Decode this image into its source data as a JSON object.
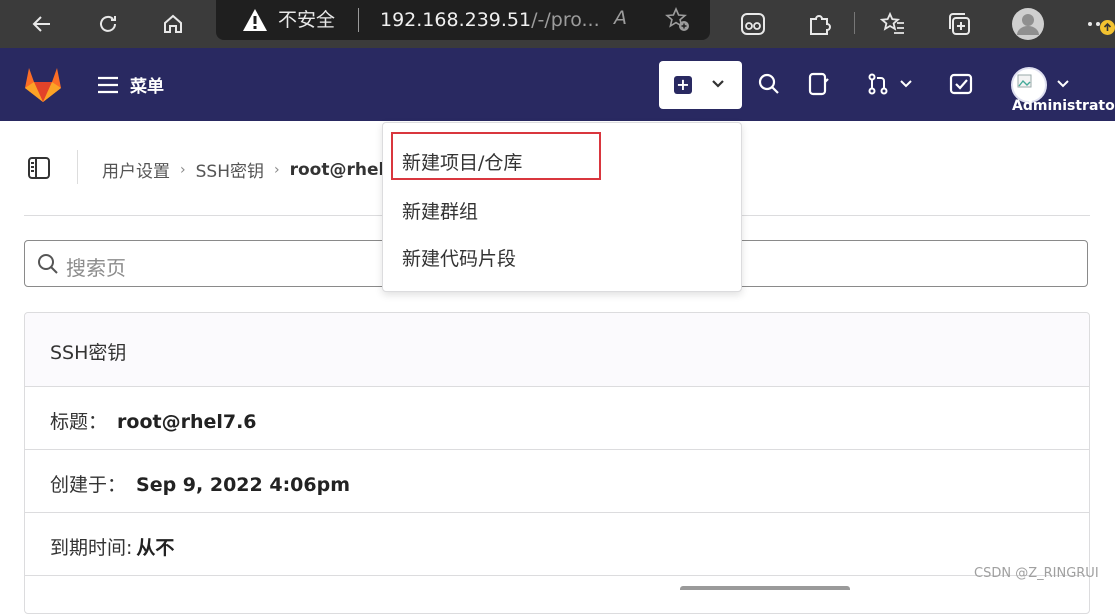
{
  "browser": {
    "insecure_label": "不安全",
    "url_host": "192.168.239.51",
    "url_path": "/-/pro...",
    "read_aloud": "A"
  },
  "nav": {
    "menu_label": "菜单",
    "user_name": "Administrato"
  },
  "breadcrumb": {
    "items": [
      "用户设置",
      "SSH密钥"
    ],
    "current": "root@rhel"
  },
  "search": {
    "placeholder": "搜索页"
  },
  "ssh_key": {
    "title": "SSH密钥",
    "rows": [
      {
        "label": "标题：",
        "value": "root@rhel7.6"
      },
      {
        "label": "创建于：",
        "value": "Sep 9, 2022 4:06pm"
      },
      {
        "label": "到期时间:",
        "value": "从不"
      }
    ]
  },
  "new_menu": {
    "items": [
      {
        "label": "新建项目/仓库",
        "highlighted": true
      },
      {
        "label": "新建群组"
      },
      {
        "label": "新建代码片段"
      }
    ]
  },
  "watermark": "CSDN @Z_RINGRUI",
  "colors": {
    "nav_bg": "#292961",
    "browser_bg": "#3b3b3b",
    "highlight_border": "#d9363e",
    "logo_orange": "#e24329"
  }
}
